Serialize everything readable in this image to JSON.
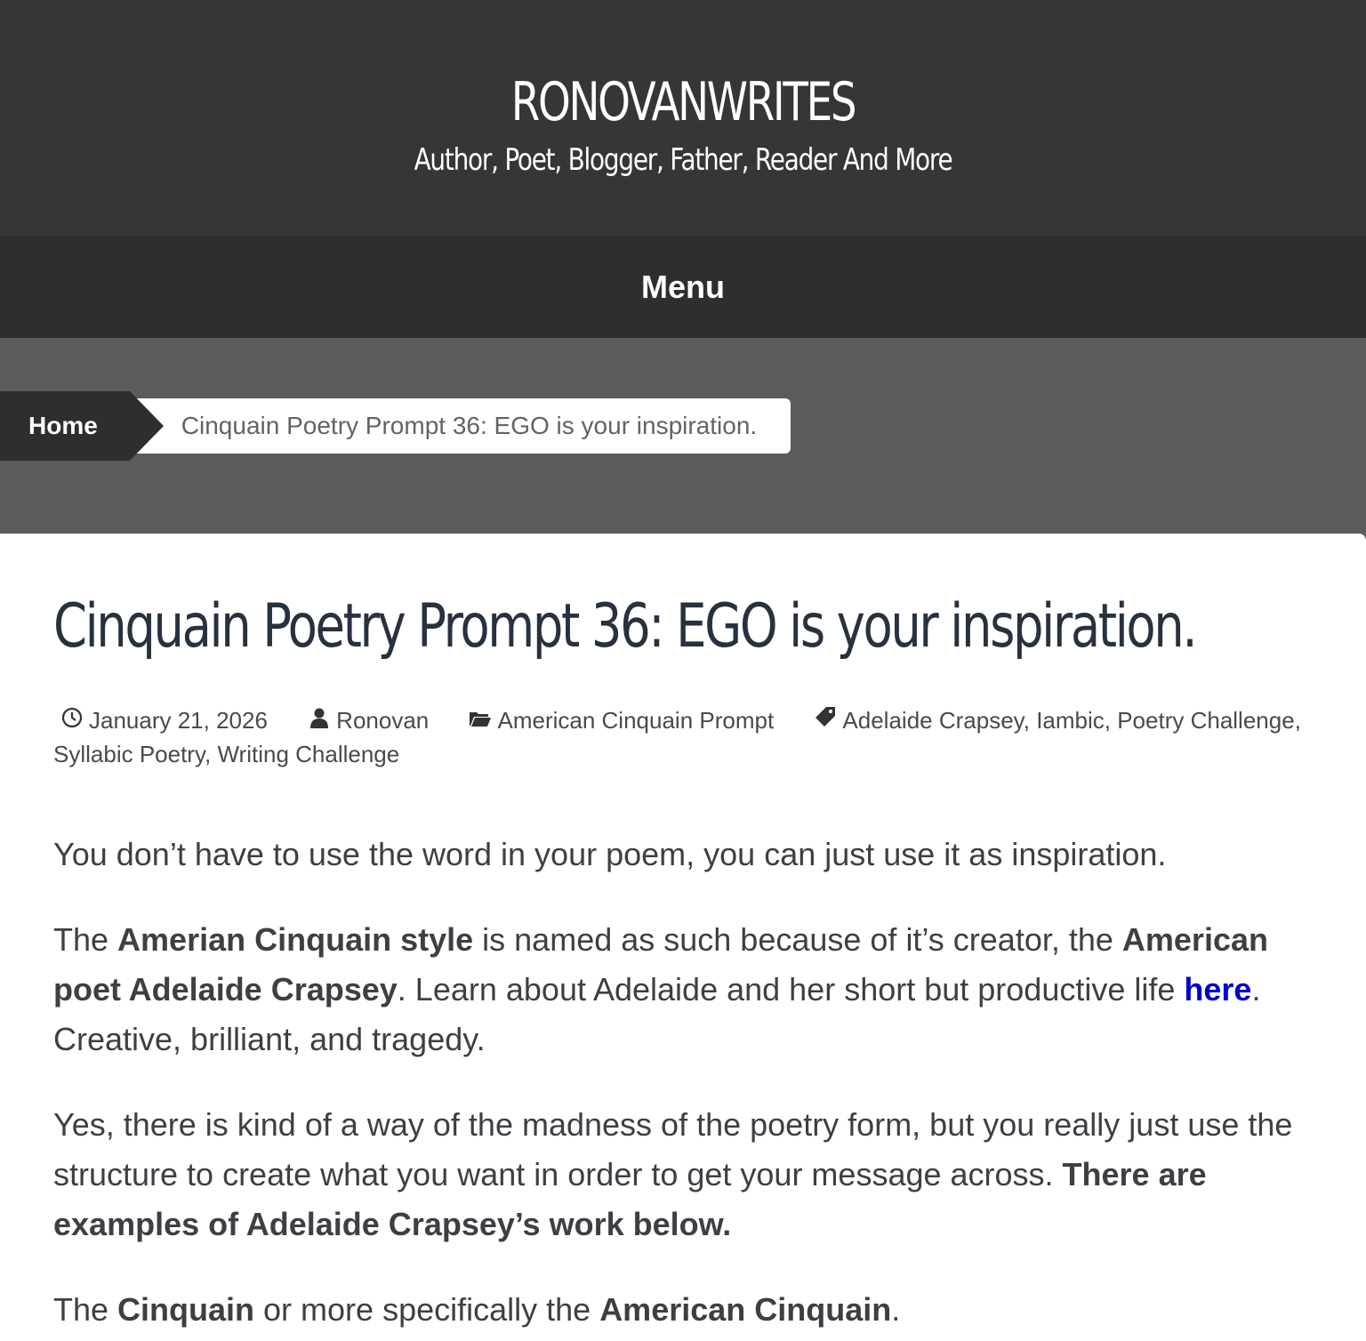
{
  "header": {
    "site_title": "RONOVANWRITES",
    "site_description": "Author, Poet, Blogger, Father, Reader And More"
  },
  "nav": {
    "menu_label": "Menu"
  },
  "breadcrumb": {
    "home_label": "Home",
    "current_label": "Cinquain Poetry Prompt 36: EGO is your inspiration."
  },
  "post": {
    "title": "Cinquain Poetry Prompt 36: EGO is your inspiration.",
    "meta": {
      "date": "January 21, 2026",
      "author": "Ronovan",
      "category": "American Cinquain Prompt",
      "tags": [
        "Adelaide Crapsey",
        "Iambic",
        "Poetry Challenge",
        "Syllabic Poetry",
        "Writing Challenge"
      ]
    },
    "p1": "You don’t have to use the word in your poem, you can just use it as inspiration.",
    "p2": {
      "t1": "The ",
      "b1": "Amerian Cinquain style",
      "t2": " is named as such because of it’s creator, the ",
      "b2": "American poet  Adelaide Crapsey",
      "t3": ". Learn about Adelaide and her short but productive life ",
      "link": "here",
      "t4": ". Creative, brilliant, and tragedy."
    },
    "p3": {
      "t1": "Yes, there is kind of a way of the madness of the poetry form, but you really just use the structure to create what you want in order to get your message across. ",
      "b1": "There are examples of Adelaide Crapsey’s work below."
    },
    "p4": {
      "t1": "The ",
      "b1": "Cinquain",
      "t2": " or more specifically the ",
      "b2": "American Cinquain",
      "t3": "."
    }
  },
  "icons": {
    "date": "clock-icon",
    "author": "user-icon",
    "category": "folder-icon",
    "tags": "tag-icon"
  }
}
